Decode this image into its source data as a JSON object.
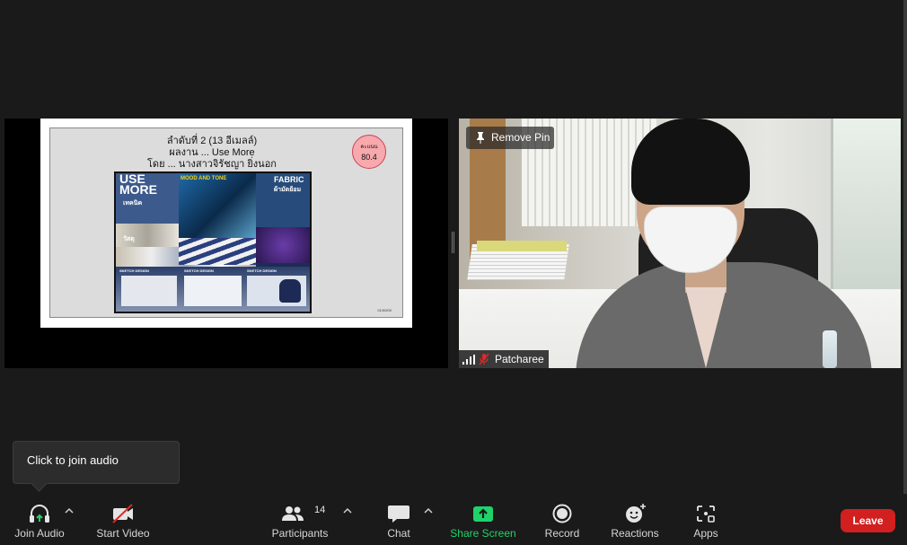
{
  "shared_content": {
    "slide_title_lines": [
      "ลำดับที่ 2 (13 อีเมลล์)",
      "ผลงาน ... Use More",
      "โดย ... นางสาวจิรัชญา ยิ่งนอก"
    ],
    "score_label": "คะแนน",
    "score_value": "80.4",
    "poster": {
      "heading_use": "USE",
      "heading_more": "MORE",
      "mood_tone": "MOOD AND TONE",
      "fabric": "FABRIC",
      "fabric_thai": "ผ้ามัดย้อม",
      "technique": "เทคนิค",
      "material": "วัสดุ",
      "sketch_labels": [
        "SKETCH DESIGN",
        "SKETCH DESIGN",
        "SKETCH DESIGN"
      ]
    },
    "page_number": "01/00/00"
  },
  "video": {
    "remove_pin_label": "Remove Pin",
    "participant_name": "Patcharee"
  },
  "tooltip": {
    "text": "Click to join audio"
  },
  "toolbar": {
    "join_audio": "Join Audio",
    "start_video": "Start Video",
    "participants": "Participants",
    "participants_count": "14",
    "chat": "Chat",
    "share_screen": "Share Screen",
    "record": "Record",
    "reactions": "Reactions",
    "apps": "Apps",
    "leave": "Leave"
  },
  "colors": {
    "share_green": "#1fd36a",
    "leave_red": "#d21f1f",
    "muted_red": "#e02828"
  },
  "icons": {
    "join_audio": "headphones-icon",
    "start_video": "video-off-icon",
    "participants": "people-icon",
    "chat": "chat-bubble-icon",
    "share_screen": "share-arrow-icon",
    "record": "record-circle-icon",
    "reactions": "smiley-plus-icon",
    "apps": "apps-grid-icon"
  }
}
